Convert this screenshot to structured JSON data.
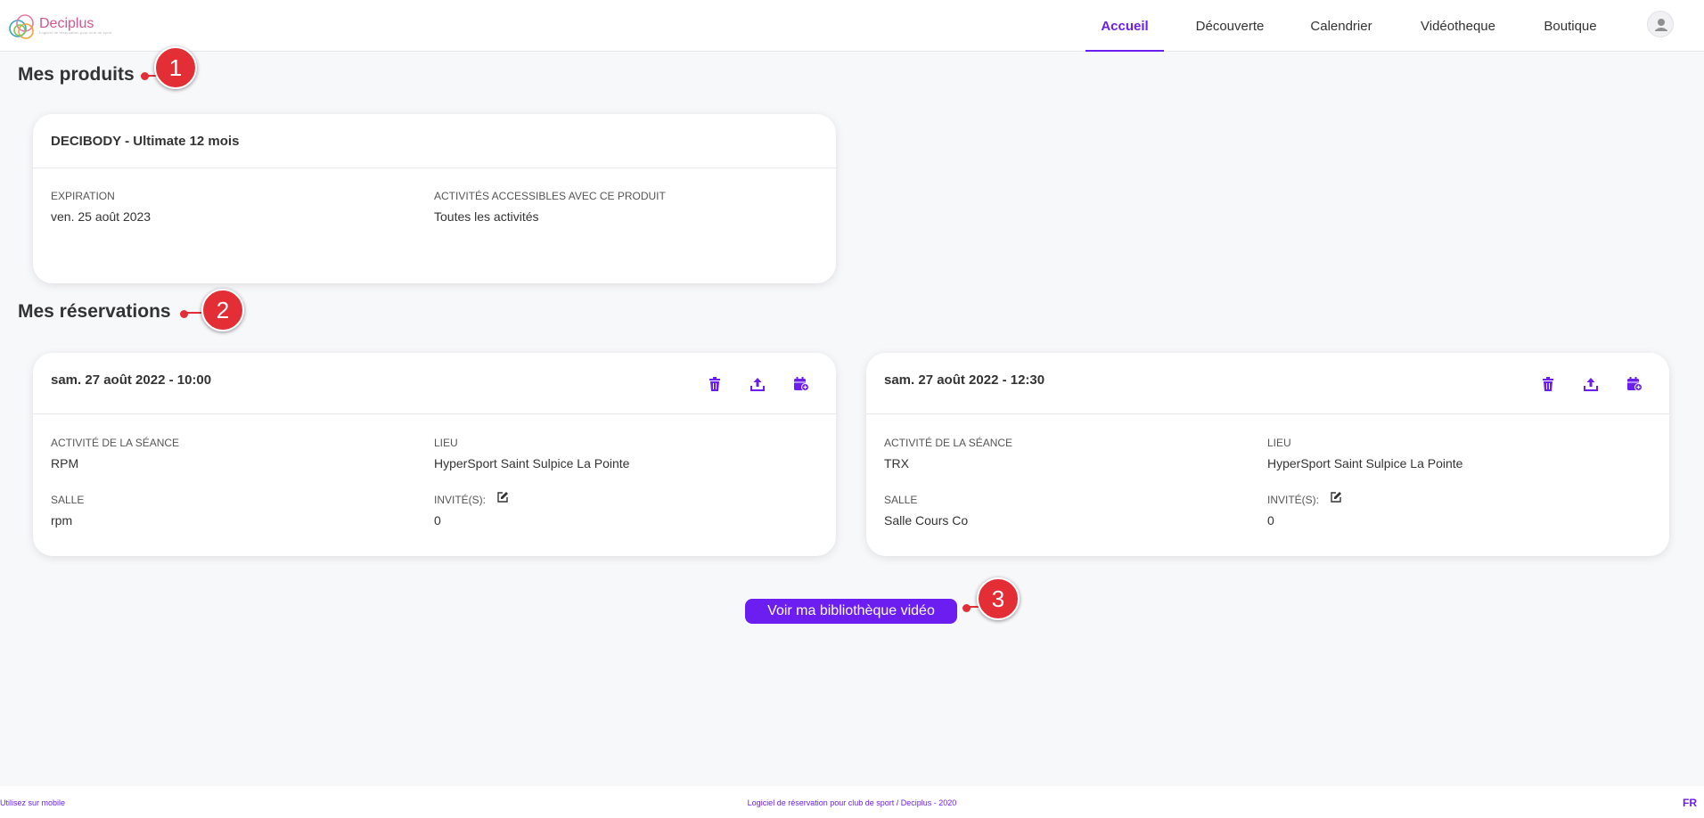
{
  "brand": {
    "name": "Deciplus",
    "tagline": "Logiciel de réservation pour club de sport"
  },
  "nav": [
    {
      "label": "Accueil",
      "active": true
    },
    {
      "label": "Découverte",
      "active": false
    },
    {
      "label": "Calendrier",
      "active": false
    },
    {
      "label": "Vidéotheque",
      "active": false
    },
    {
      "label": "Boutique",
      "active": false
    }
  ],
  "colors": {
    "accent": "#6c1ef0",
    "marker": "#e42e36",
    "background": "#f7f8fa"
  },
  "products": {
    "title": "Mes produits",
    "items": [
      {
        "name": "DECIBODY - Ultimate 12 mois",
        "expiration_label": "EXPIRATION",
        "expiration_value": "ven. 25 août 2023",
        "activities_label": "ACTIVITÉS ACCESSIBLES AVEC CE PRODUIT",
        "activities_value": "Toutes les activités"
      }
    ]
  },
  "reservations": {
    "title": "Mes réservations",
    "items": [
      {
        "datetime": "sam. 27 août 2022 - 10:00",
        "activity_label": "ACTIVITÉ DE LA SÉANCE",
        "activity_value": "RPM",
        "location_label": "LIEU",
        "location_value": "HyperSport Saint Sulpice La Pointe",
        "room_label": "SALLE",
        "room_value": "rpm",
        "guests_label": "INVITÉ(S):",
        "guests_value": "0"
      },
      {
        "datetime": "sam. 27 août 2022 - 12:30",
        "activity_label": "ACTIVITÉ DE LA SÉANCE",
        "activity_value": "TRX",
        "location_label": "LIEU",
        "location_value": "HyperSport Saint Sulpice La Pointe",
        "room_label": "SALLE",
        "room_value": "Salle Cours Co",
        "guests_label": "INVITÉ(S):",
        "guests_value": "0"
      }
    ],
    "icons": [
      "trash-icon",
      "share-icon",
      "calendar-add-icon",
      "edit-icon"
    ]
  },
  "video_button": {
    "label": "Voir ma bibliothèque vidéo"
  },
  "markers": [
    "1",
    "2",
    "3"
  ],
  "footer": {
    "mobile": "Utilisez sur mobile",
    "credit": "Logiciel de réservation pour club de sport / Deciplus - 2020",
    "lang": "FR"
  }
}
